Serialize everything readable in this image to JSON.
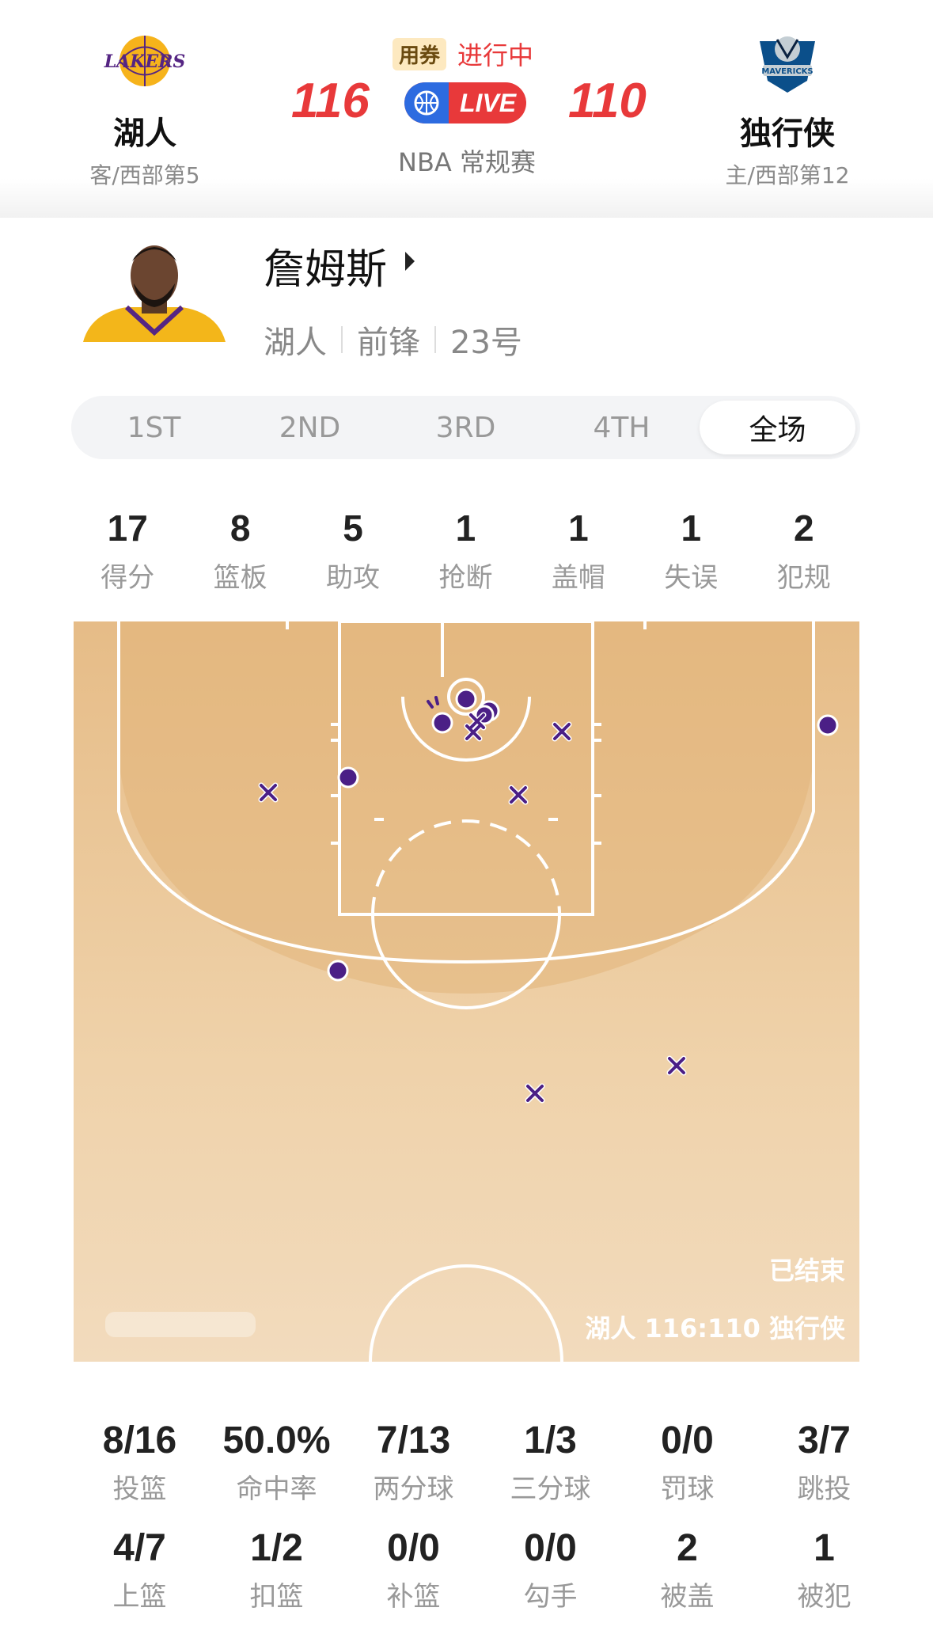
{
  "header": {
    "away": {
      "name": "湖人",
      "rank": "客/西部第5",
      "score": "116",
      "logo": "lakers-logo"
    },
    "home": {
      "name": "独行侠",
      "rank": "主/西部第12",
      "score": "110",
      "logo": "mavericks-logo"
    },
    "coupon": "用券",
    "status": "进行中",
    "live": "LIVE",
    "league": "NBA 常规赛"
  },
  "player": {
    "name": "詹姆斯",
    "team": "湖人",
    "position": "前锋",
    "number": "23号"
  },
  "tabs": [
    "1ST",
    "2ND",
    "3RD",
    "4TH",
    "全场"
  ],
  "active_tab": "全场",
  "summary": [
    {
      "value": "17",
      "label": "得分"
    },
    {
      "value": "8",
      "label": "篮板"
    },
    {
      "value": "5",
      "label": "助攻"
    },
    {
      "value": "1",
      "label": "抢断"
    },
    {
      "value": "1",
      "label": "盖帽"
    },
    {
      "value": "1",
      "label": "失误"
    },
    {
      "value": "2",
      "label": "犯规"
    }
  ],
  "court": {
    "status": "已结束",
    "final_score": "湖人 116:110 独行侠",
    "marker_color": "#4b1f86",
    "made_shots_count": 8,
    "missed_shots_count": 8
  },
  "shooting": {
    "row1": [
      {
        "value": "8/16",
        "label": "投篮"
      },
      {
        "value": "50.0%",
        "label": "命中率"
      },
      {
        "value": "7/13",
        "label": "两分球"
      },
      {
        "value": "1/3",
        "label": "三分球"
      },
      {
        "value": "0/0",
        "label": "罚球"
      },
      {
        "value": "3/7",
        "label": "跳投"
      }
    ],
    "row2": [
      {
        "value": "4/7",
        "label": "上篮"
      },
      {
        "value": "1/2",
        "label": "扣篮"
      },
      {
        "value": "0/0",
        "label": "补篮"
      },
      {
        "value": "0/0",
        "label": "勾手"
      },
      {
        "value": "2",
        "label": "被盖"
      },
      {
        "value": "1",
        "label": "被犯"
      }
    ]
  },
  "colors": {
    "accent_red": "#e8393a",
    "live_blue": "#2d6be0",
    "court": "#e6bc87"
  }
}
